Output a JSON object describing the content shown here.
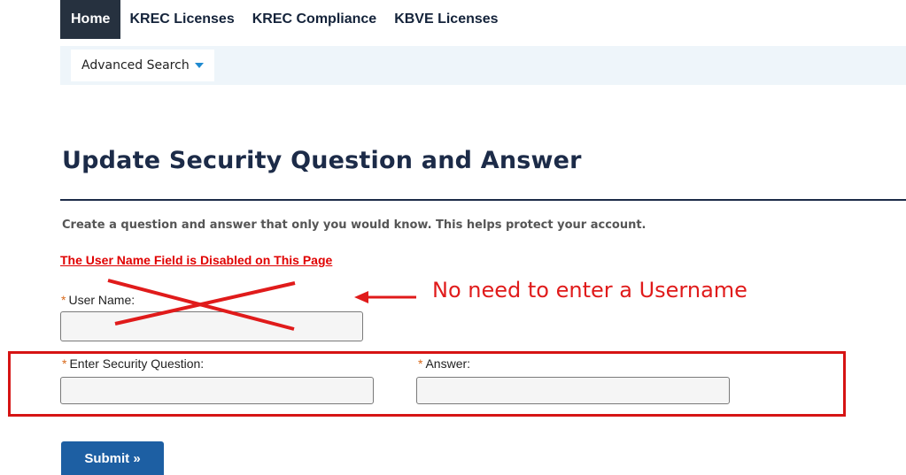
{
  "nav": {
    "tabs": [
      {
        "label": "Home",
        "active": true
      },
      {
        "label": "KREC Licenses"
      },
      {
        "label": "KREC Compliance"
      },
      {
        "label": "KBVE Licenses"
      }
    ],
    "sub_menu": {
      "label": "Advanced Search",
      "icon": "caret-down-icon"
    }
  },
  "page": {
    "title": "Update Security Question and Answer",
    "description": "Create a question and answer that only you would know. This helps protect your account."
  },
  "annotation": {
    "disabled_note": "The User Name Field is Disabled on This Page",
    "callout_text": "No need to enter a Username",
    "color": "#e01b1b"
  },
  "form": {
    "required_marker": "*",
    "username_label": "User Name:",
    "username_value": "",
    "security_question_label": "Enter Security Question:",
    "security_question_value": "",
    "answer_label": "Answer:",
    "answer_value": "",
    "submit_label": "Submit »"
  },
  "colors": {
    "nav_active_bg": "#26313f",
    "title": "#1c2b48",
    "required": "#d86a1c",
    "button": "#1d5fa3",
    "subnav_bg": "#eef5fa"
  }
}
